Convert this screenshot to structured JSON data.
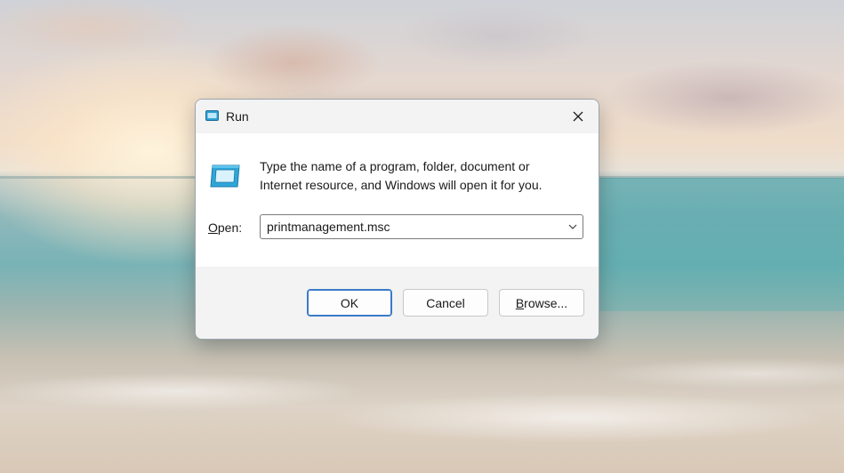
{
  "window": {
    "title": "Run"
  },
  "body": {
    "description_line1": "Type the name of a program, folder, document or",
    "description_line2": "Internet resource, and Windows will open it for you.",
    "open_label_accel": "O",
    "open_label_rest": "pen:",
    "open_value": "printmanagement.msc"
  },
  "buttons": {
    "ok": "OK",
    "cancel": "Cancel",
    "browse_accel": "B",
    "browse_rest": "rowse..."
  },
  "icons": {
    "app": "run-app-icon",
    "close": "close-icon",
    "dropdown": "chevron-down-icon"
  },
  "colors": {
    "accent": "#3a7bc8",
    "titlebar": "#f3f3f3"
  }
}
